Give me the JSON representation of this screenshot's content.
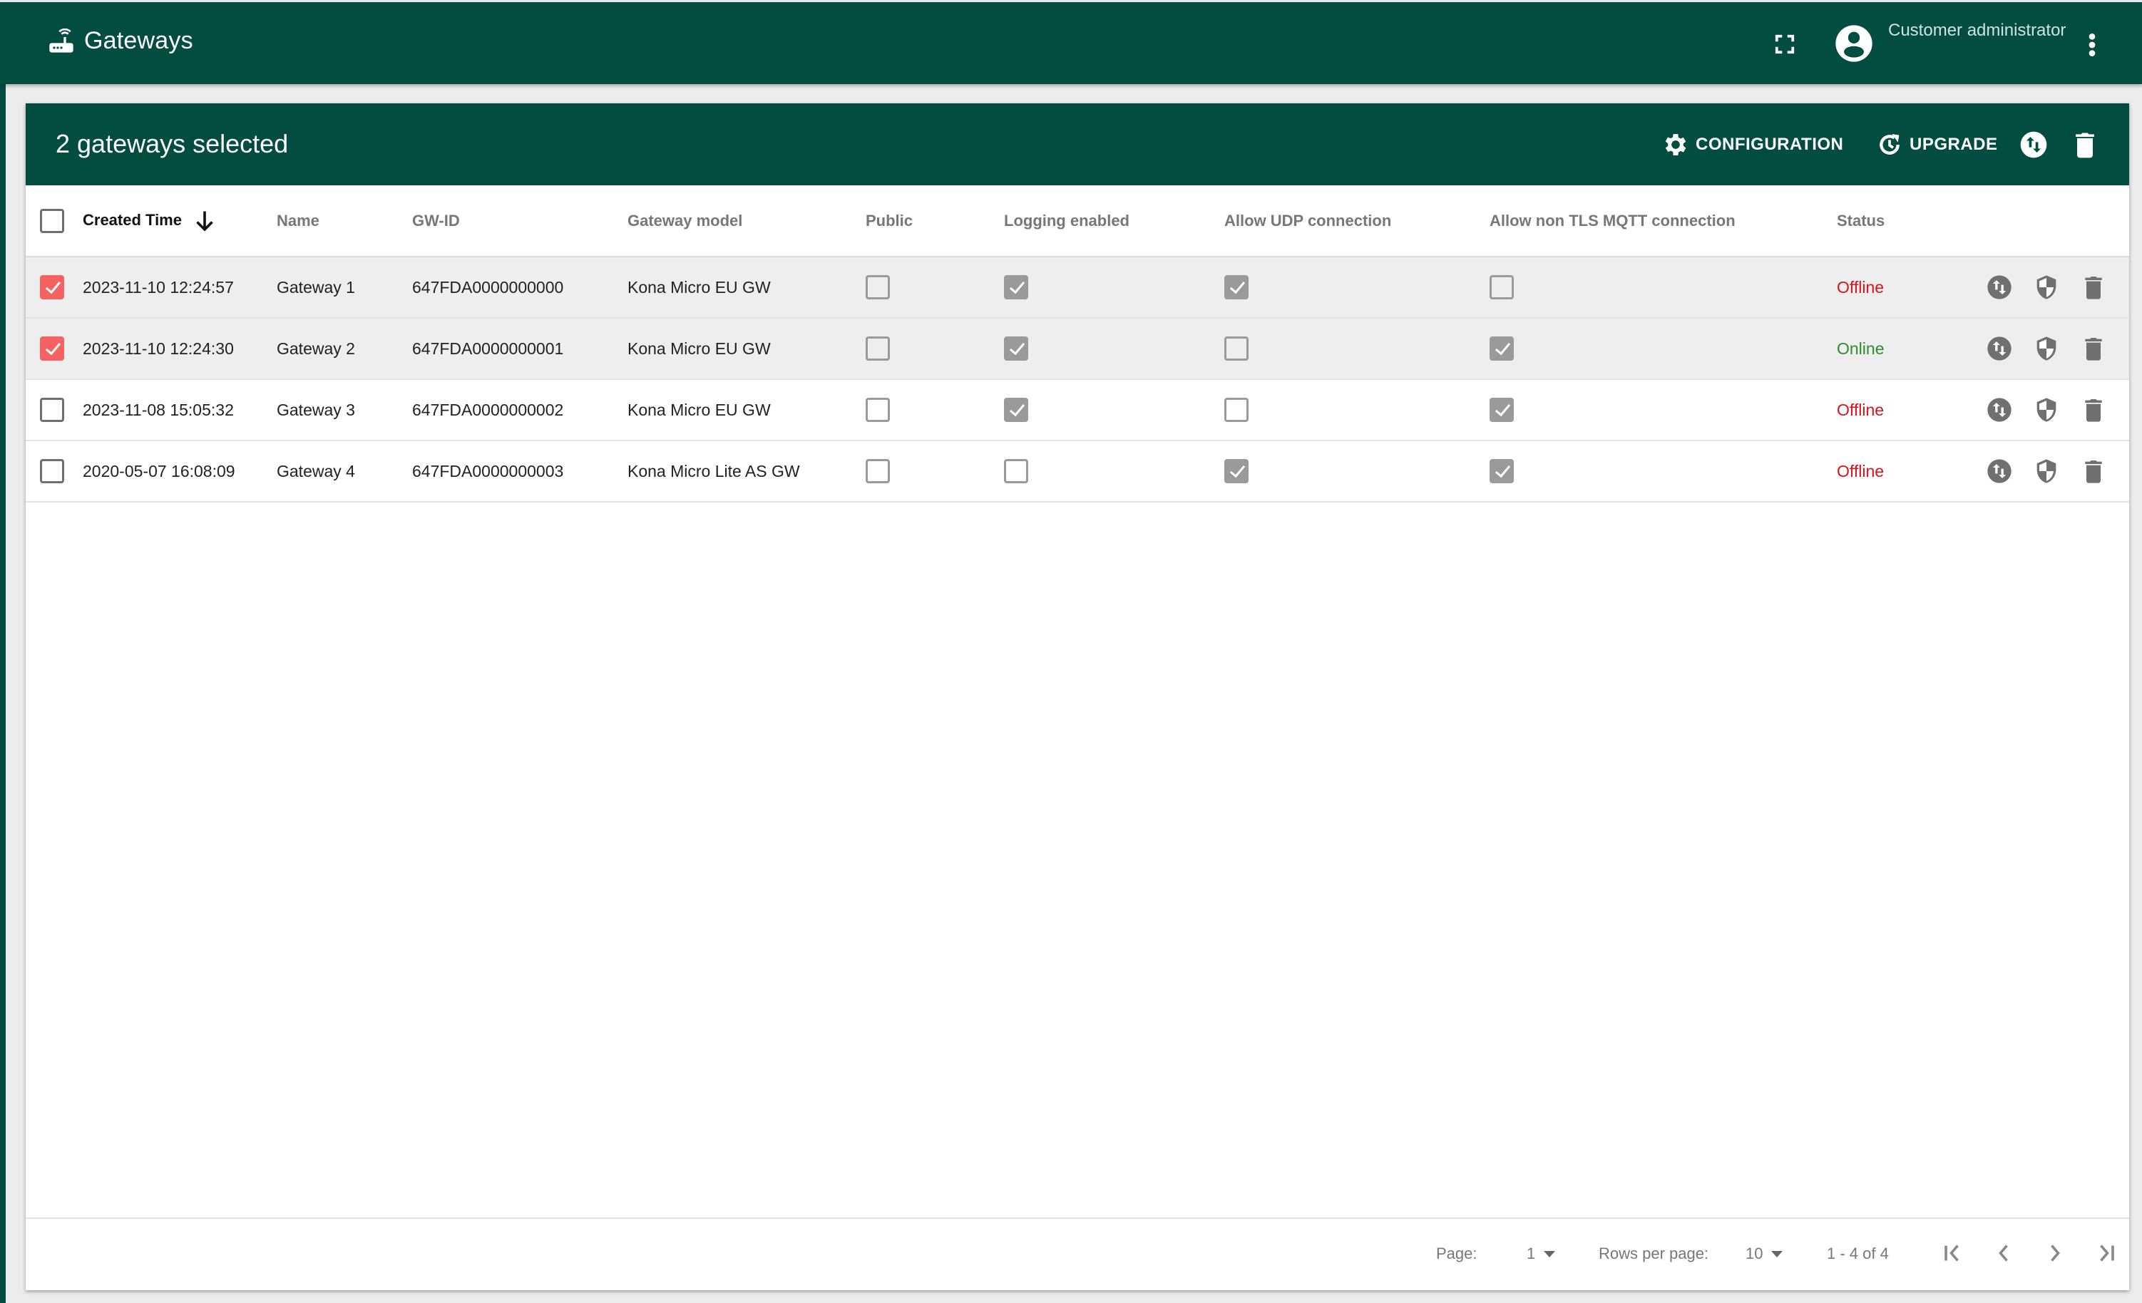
{
  "app": {
    "title": "Gateways",
    "icon": "router-icon",
    "user_label": "Customer administrator",
    "colors": {
      "primary": "#034d40",
      "selected_checkbox": "#f46262",
      "offline": "#d9121c",
      "online": "#2e8b2e"
    }
  },
  "toolbar": {
    "selection_text": "2 gateways selected",
    "configuration_label": "CONFIGURATION",
    "upgrade_label": "UPGRADE"
  },
  "table": {
    "columns": [
      {
        "key": "created_time",
        "label": "Created Time",
        "sorted": "desc"
      },
      {
        "key": "name",
        "label": "Name"
      },
      {
        "key": "gw_id",
        "label": "GW-ID"
      },
      {
        "key": "model",
        "label": "Gateway model"
      },
      {
        "key": "public",
        "label": "Public"
      },
      {
        "key": "logging",
        "label": "Logging enabled"
      },
      {
        "key": "udp",
        "label": "Allow UDP connection"
      },
      {
        "key": "non_tls",
        "label": "Allow non TLS MQTT connection"
      },
      {
        "key": "status",
        "label": "Status"
      }
    ],
    "rows": [
      {
        "selected": true,
        "created_time": "2023-11-10 12:24:57",
        "name": "Gateway 1",
        "gw_id": "647FDA0000000000",
        "model": "Kona Micro EU GW",
        "public": false,
        "logging": true,
        "udp": true,
        "non_tls": false,
        "status": "Offline"
      },
      {
        "selected": true,
        "created_time": "2023-11-10 12:24:30",
        "name": "Gateway 2",
        "gw_id": "647FDA0000000001",
        "model": "Kona Micro EU GW",
        "public": false,
        "logging": true,
        "udp": false,
        "non_tls": true,
        "status": "Online"
      },
      {
        "selected": false,
        "created_time": "2023-11-08 15:05:32",
        "name": "Gateway 3",
        "gw_id": "647FDA0000000002",
        "model": "Kona Micro EU GW",
        "public": false,
        "logging": true,
        "udp": false,
        "non_tls": true,
        "status": "Offline"
      },
      {
        "selected": false,
        "created_time": "2020-05-07 16:08:09",
        "name": "Gateway 4",
        "gw_id": "647FDA0000000003",
        "model": "Kona Micro Lite AS GW",
        "public": false,
        "logging": false,
        "udp": true,
        "non_tls": true,
        "status": "Offline"
      }
    ]
  },
  "pagination": {
    "page_label": "Page:",
    "page_value": "1",
    "rows_label": "Rows per page:",
    "rows_value": "10",
    "range_text": "1 - 4 of 4"
  }
}
